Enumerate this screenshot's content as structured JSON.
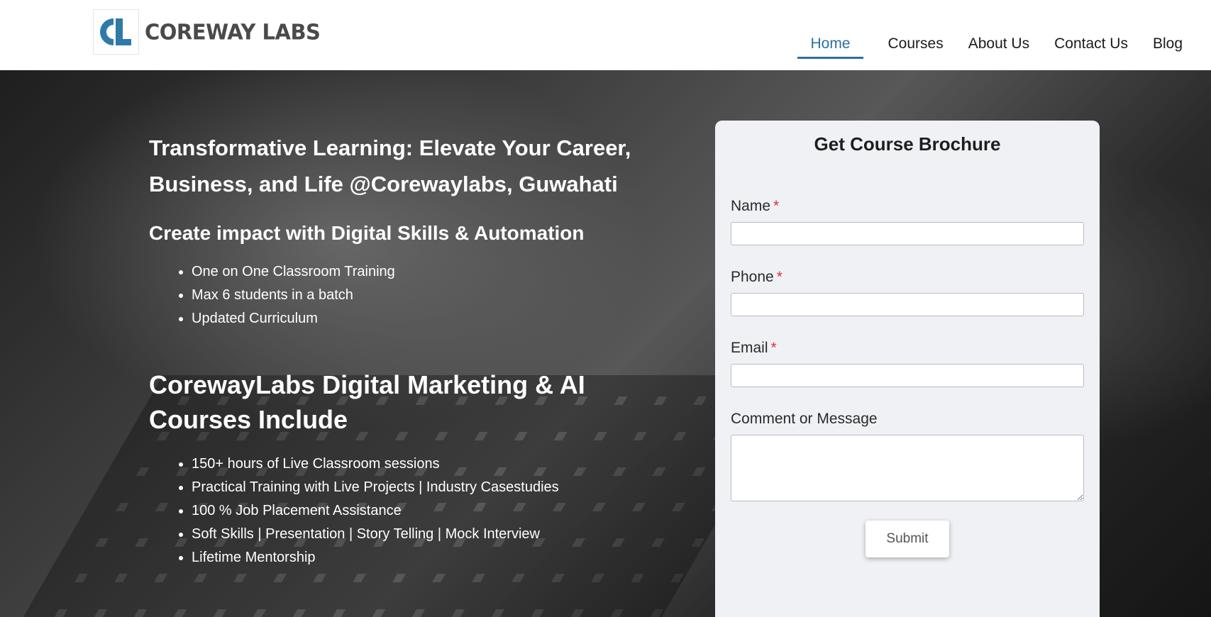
{
  "brand": {
    "name": "COREWAY LABS",
    "logo_initials": "CL"
  },
  "nav": {
    "items": [
      {
        "label": "Home",
        "active": true
      },
      {
        "label": "Courses",
        "active": false
      },
      {
        "label": "About Us",
        "active": false
      },
      {
        "label": "Contact Us",
        "active": false
      },
      {
        "label": "Blog",
        "active": false
      }
    ]
  },
  "hero": {
    "title": "Transformative Learning: Elevate Your Career, Business, and Life @Corewaylabs, Guwahati",
    "subtitle": "Create impact with Digital Skills & Automation",
    "highlights": [
      "One on One Classroom Training",
      "Max 6 students in a batch",
      "Updated Curriculum"
    ],
    "courses_title": "CorewayLabs Digital Marketing & AI Courses Include",
    "courses_features": [
      "150+ hours of Live Classroom sessions",
      "Practical Training with Live Projects | Industry Casestudies",
      "100 % Job Placement Assistance",
      "Soft Skills | Presentation | Story Telling | Mock Interview",
      "Lifetime Mentorship"
    ]
  },
  "form": {
    "title": "Get Course Brochure",
    "fields": [
      {
        "label": "Name",
        "required": true,
        "value": ""
      },
      {
        "label": "Phone",
        "required": true,
        "value": ""
      },
      {
        "label": "Email",
        "required": true,
        "value": ""
      },
      {
        "label": "Comment or Message",
        "required": false,
        "value": ""
      }
    ],
    "required_marker": "*",
    "submit_label": "Submit"
  },
  "colors": {
    "accent": "#2e6f9e",
    "required": "#d9323c",
    "form_bg": "#f0f1f5"
  }
}
